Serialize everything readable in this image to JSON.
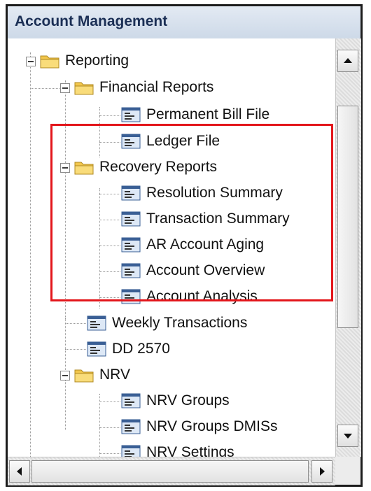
{
  "panel": {
    "title": "Account Management"
  },
  "tree": {
    "items": [
      {
        "label": "Reporting",
        "icon": "folder-icon",
        "expanded": true
      },
      {
        "label": "Financial Reports",
        "icon": "folder-icon",
        "expanded": true
      },
      {
        "label": "Permanent Bill File",
        "icon": "report-icon"
      },
      {
        "label": "Ledger File",
        "icon": "report-icon"
      },
      {
        "label": "Recovery Reports",
        "icon": "folder-icon",
        "expanded": true
      },
      {
        "label": "Resolution Summary",
        "icon": "report-icon"
      },
      {
        "label": "Transaction Summary",
        "icon": "report-icon"
      },
      {
        "label": "AR Account Aging",
        "icon": "report-icon"
      },
      {
        "label": "Account Overview",
        "icon": "report-icon"
      },
      {
        "label": "Account Analysis",
        "icon": "report-icon"
      },
      {
        "label": "Weekly Transactions",
        "icon": "report-icon"
      },
      {
        "label": "DD 2570",
        "icon": "report-icon"
      },
      {
        "label": "NRV",
        "icon": "folder-icon",
        "expanded": true
      },
      {
        "label": "NRV Groups",
        "icon": "report-icon"
      },
      {
        "label": "NRV Groups DMISs",
        "icon": "report-icon"
      },
      {
        "label": "NRV Settings",
        "icon": "report-icon"
      }
    ]
  },
  "colors": {
    "highlight": "#e3161b",
    "header_text": "#1b2f55",
    "folder": "#f2c64c"
  }
}
